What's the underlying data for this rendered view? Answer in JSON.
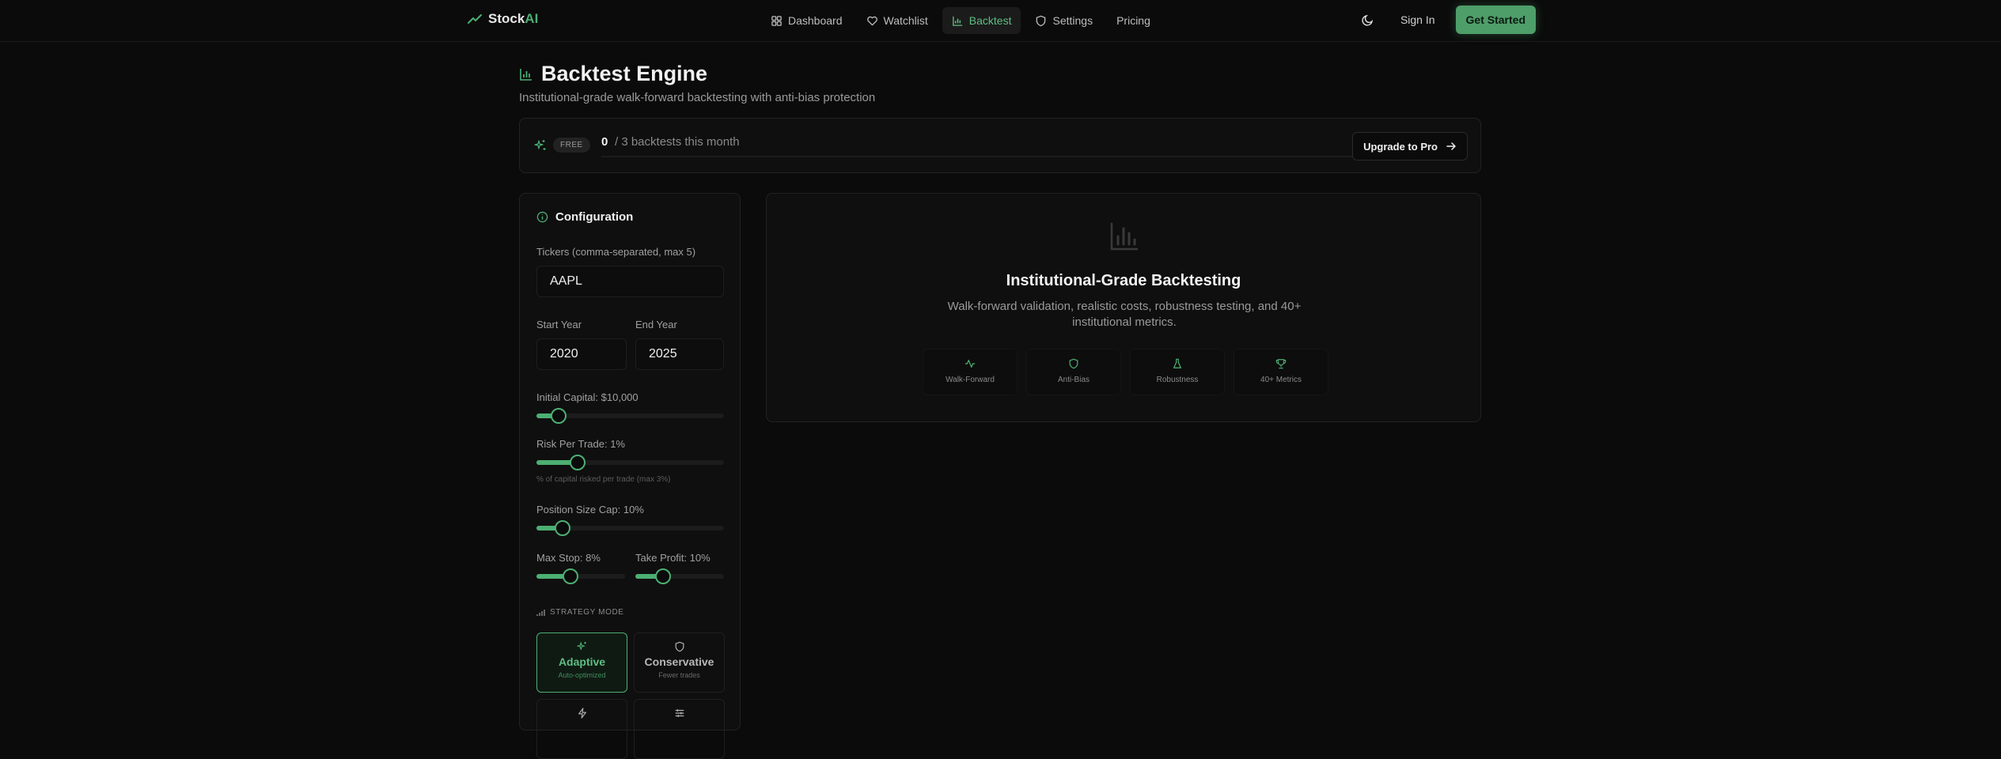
{
  "brand": {
    "name_part1": "Stock",
    "name_part2": "AI"
  },
  "nav": {
    "items": [
      {
        "label": "Dashboard"
      },
      {
        "label": "Watchlist"
      },
      {
        "label": "Backtest"
      },
      {
        "label": "Settings"
      },
      {
        "label": "Pricing"
      }
    ],
    "active": "Backtest",
    "signin": "Sign In",
    "get_started": "Get Started"
  },
  "page": {
    "title": "Backtest Engine",
    "subtitle": "Institutional-grade walk-forward backtesting with anti-bias protection"
  },
  "usage": {
    "plan_badge": "FREE",
    "used": "0",
    "limit_text": "/ 3 backtests this month",
    "used_fraction": 0,
    "upgrade_label": "Upgrade to Pro"
  },
  "config": {
    "title": "Configuration",
    "tickers_label": "Tickers (comma-separated, max 5)",
    "tickers_value": "AAPL",
    "start_year_label": "Start Year",
    "start_year_value": "2020",
    "end_year_label": "End Year",
    "end_year_value": "2025",
    "initial_capital_label": "Initial Capital: $10,000",
    "initial_capital_level": 0.12,
    "risk_label": "Risk Per Trade: 1%",
    "risk_level": 0.22,
    "risk_hint": "% of capital risked per trade (max 3%)",
    "position_cap_label": "Position Size Cap: 10%",
    "position_cap_level": 0.14,
    "max_stop_label": "Max Stop: 8%",
    "max_stop_level": 0.38,
    "take_profit_label": "Take Profit: 10%",
    "take_profit_level": 0.31,
    "strategy_mode_label": "STRATEGY MODE",
    "modes": [
      {
        "name": "Adaptive",
        "desc": "Auto-optimized",
        "active": true
      },
      {
        "name": "Conservative",
        "desc": "Fewer trades",
        "active": false
      }
    ]
  },
  "hero": {
    "title": "Institutional-Grade Backtesting",
    "description": "Walk-forward validation, realistic costs, robustness testing, and 40+ institutional metrics.",
    "features": [
      {
        "label": "Walk-Forward"
      },
      {
        "label": "Anti-Bias"
      },
      {
        "label": "Robustness"
      },
      {
        "label": "40+ Metrics"
      }
    ]
  },
  "colors": {
    "accent": "#4caf73",
    "background": "#0b0b0b",
    "panel": "#0f0f0f"
  }
}
